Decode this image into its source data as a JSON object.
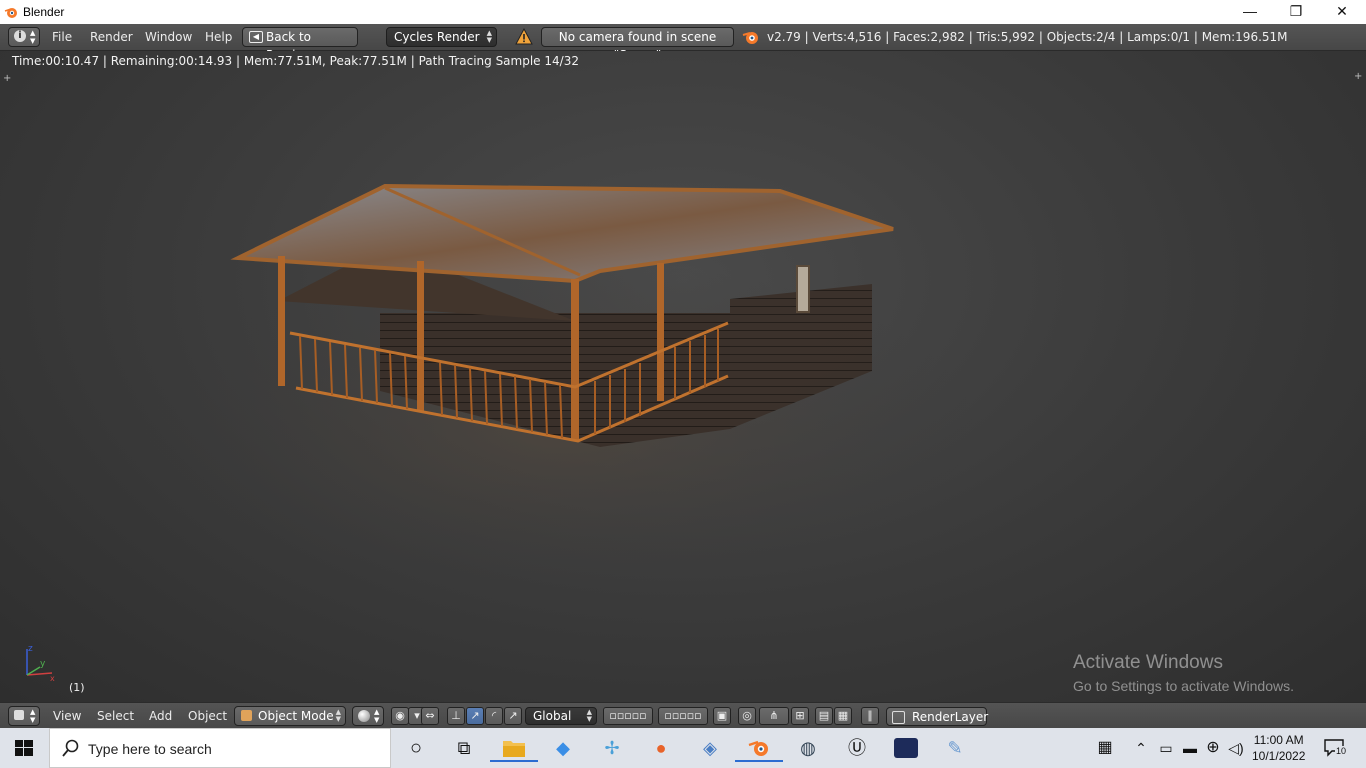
{
  "window": {
    "title": "Blender",
    "controls": [
      "—",
      "❐",
      "✕"
    ]
  },
  "info_header": {
    "menus": [
      "File",
      "Render",
      "Window",
      "Help"
    ],
    "back_button": "Back to Previous",
    "render_engine": "Cycles Render",
    "warning": "No camera found in scene \"Scene\"",
    "stats": "v2.79 | Verts:4,516 | Faces:2,982 | Tris:5,992 | Objects:2/4 | Lamps:0/1 | Mem:196.51M"
  },
  "viewport": {
    "render_status": "Time:00:10.47 | Remaining:00:14.93 | Mem:77.51M, Peak:77.51M | Path Tracing Sample 14/32",
    "frame_number": "(1)",
    "axis_labels": {
      "z": "z",
      "y": "y",
      "x": "x"
    },
    "watermark_title": "Activate Windows",
    "watermark_sub": "Go to Settings to activate Windows."
  },
  "view3d_header": {
    "menus": [
      "View",
      "Select",
      "Add",
      "Object"
    ],
    "mode": "Object Mode",
    "orientation": "Global",
    "render_layer": "RenderLayer"
  },
  "taskbar": {
    "search_placeholder": "Type here to search",
    "time": "11:00 AM",
    "date": "10/1/2022",
    "notification_count": "10"
  },
  "colors": {
    "blender_header": "#4f4f4f",
    "viewport_bg": "#3d3d3d",
    "active_tool": "#5680c2",
    "warning": "#f0a33b",
    "taskbar": "#dfe3ea"
  }
}
